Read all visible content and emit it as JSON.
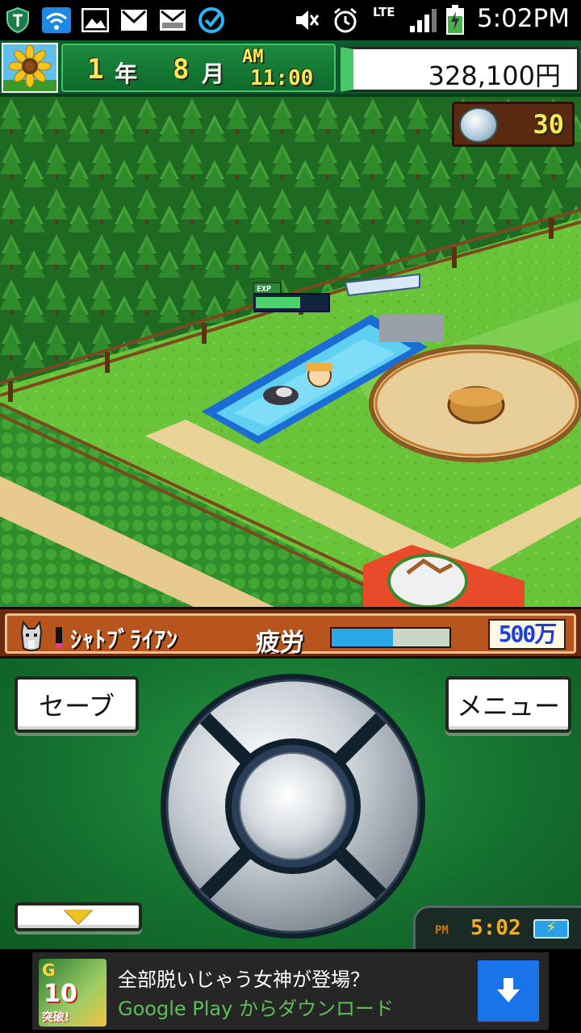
{
  "status_bar": {
    "time": "5:02PM",
    "network": "LTE",
    "icons": [
      "shield-icon",
      "wifi-icon",
      "image-icon",
      "gmail-icon",
      "email-icon",
      "sync-check-icon",
      "mute-icon",
      "alarm-icon",
      "signal-icon",
      "battery-charging-icon"
    ]
  },
  "hud": {
    "year_num": "1",
    "year_unit": "年",
    "month_num": "8",
    "month_unit": "月",
    "ampm": "AM",
    "clock": "11:00",
    "money": "328,100円"
  },
  "field": {
    "medal_count": "30",
    "exp_label": "EXP",
    "exp_progress": 0.62
  },
  "horse": {
    "name": "ｼｬﾄﾌﾞﾗｲｱﾝ",
    "fatigue_label": "疲労",
    "fatigue": 0.52,
    "prize": "500万"
  },
  "controls": {
    "save_label": "セーブ",
    "menu_label": "メニュー",
    "clock_ampm": "PM",
    "clock_time": "5:02"
  },
  "ad": {
    "thumb_brand": "G",
    "thumb_number": "10",
    "thumb_text": "突破!",
    "title": "全部脱いじゃう女神が登場？",
    "subtitle": "Google Play からダウンロード"
  },
  "colors": {
    "hud_green": "#0d5a2c",
    "money_accent": "#49c86a",
    "digit_yellow": "#fbe85a",
    "fatigue_blue": "#2aa7e6",
    "prize_blue": "#1b3ee0",
    "ad_download": "#1a73e8"
  }
}
